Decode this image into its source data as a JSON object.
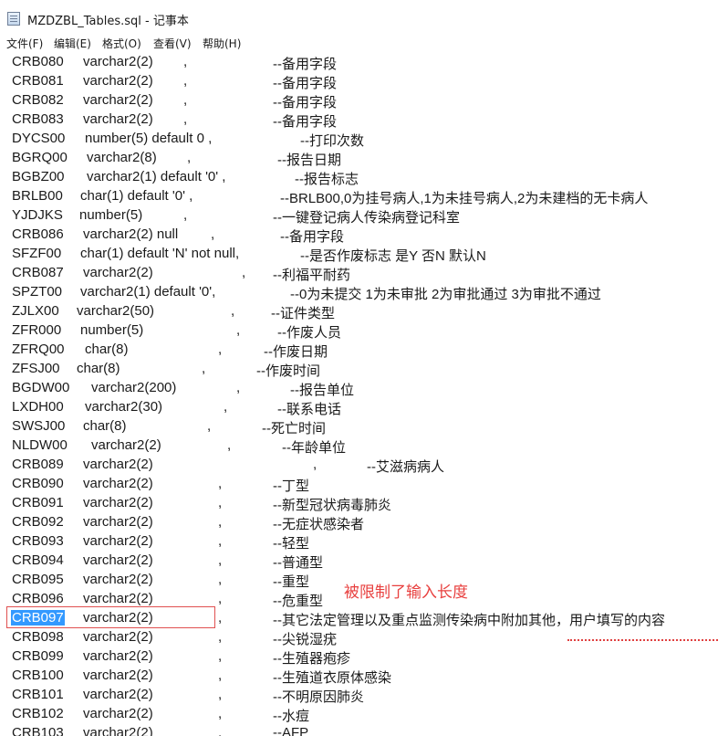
{
  "window": {
    "title": "MZDZBL_Tables.sql - 记事本"
  },
  "menu": {
    "file": "文件(F)",
    "edit": "编辑(E)",
    "format": "格式(O)",
    "view": "查看(V)",
    "help": "帮助(H)"
  },
  "annotation": {
    "text": "被限制了输入长度"
  },
  "lines": [
    {
      "name": "CRB080",
      "type": "varchar2(2)",
      "sep": ",",
      "comment": "--备用字段"
    },
    {
      "name": "CRB081",
      "type": "varchar2(2)",
      "sep": ",",
      "comment": "--备用字段"
    },
    {
      "name": "CRB082",
      "type": "varchar2(2)",
      "sep": ",",
      "comment": "--备用字段"
    },
    {
      "name": "CRB083",
      "type": "varchar2(2)",
      "sep": ",",
      "comment": "--备用字段"
    },
    {
      "name": "DYCS00",
      "type": "number(5) default 0 ,",
      "sep": "",
      "comment": "--打印次数"
    },
    {
      "name": "BGRQ00",
      "type": "varchar2(8)",
      "sep": ",",
      "comment": "--报告日期"
    },
    {
      "name": "BGBZ00",
      "type": "varchar2(1) default '0' ,",
      "sep": "",
      "comment": "--报告标志"
    },
    {
      "name": "BRLB00",
      "type": "char(1) default '0' ,",
      "sep": "",
      "comment": "--BRLB00,0为挂号病人,1为未挂号病人,2为未建档的无卡病人"
    },
    {
      "name": "YJDJKS",
      "type": "number(5)",
      "sep": ",",
      "comment": "--一键登记病人传染病登记科室"
    },
    {
      "name": "CRB086",
      "type": "varchar2(2) null",
      "sep": ",",
      "comment": "--备用字段"
    },
    {
      "name": "SFZF00",
      "type": "char(1) default 'N' not null,",
      "sep": "",
      "comment": "--是否作废标志 是Y 否N 默认N"
    },
    {
      "name": "CRB087",
      "type": "varchar2(2)",
      "sep": ",",
      "comment": "--利福平耐药"
    },
    {
      "name": "SPZT00",
      "type": "varchar2(1) default '0',",
      "sep": "",
      "comment": "--0为未提交 1为未审批 2为审批通过 3为审批不通过"
    },
    {
      "name": "ZJLX00",
      "type": "varchar2(50)",
      "sep": ",",
      "comment": "--证件类型"
    },
    {
      "name": "ZFR000",
      "type": "number(5)",
      "sep": ",",
      "comment": "--作废人员"
    },
    {
      "name": "ZFRQ00",
      "type": "char(8)",
      "sep": ",",
      "comment": "--作废日期"
    },
    {
      "name": "ZFSJ00",
      "type": "char(8)",
      "sep": ",",
      "comment": "--作废时间"
    },
    {
      "name": "BGDW00",
      "type": "varchar2(200)",
      "sep": ",",
      "comment": "--报告单位"
    },
    {
      "name": "LXDH00",
      "type": "varchar2(30)",
      "sep": ",",
      "comment": "--联系电话"
    },
    {
      "name": "SWSJ00",
      "type": "char(8)",
      "sep": ",",
      "comment": "--死亡时间"
    },
    {
      "name": "NLDW00",
      "type": "varchar2(2)",
      "sep": ",",
      "comment": "--年龄单位"
    },
    {
      "name": "CRB089",
      "type": "varchar2(2)",
      "sep": ",",
      "comment": "--艾滋病病人"
    },
    {
      "name": "CRB090",
      "type": "varchar2(2)",
      "sep": ",",
      "comment": "--丁型"
    },
    {
      "name": "CRB091",
      "type": "varchar2(2)",
      "sep": ",",
      "comment": "--新型冠状病毒肺炎"
    },
    {
      "name": "CRB092",
      "type": "varchar2(2)",
      "sep": ",",
      "comment": "--无症状感染者"
    },
    {
      "name": "CRB093",
      "type": "varchar2(2)",
      "sep": ",",
      "comment": "--轻型"
    },
    {
      "name": "CRB094",
      "type": "varchar2(2)",
      "sep": ",",
      "comment": "--普通型"
    },
    {
      "name": "CRB095",
      "type": "varchar2(2)",
      "sep": ",",
      "comment": "--重型"
    },
    {
      "name": "CRB096",
      "type": "varchar2(2)",
      "sep": ",",
      "comment": "--危重型"
    },
    {
      "name": "CRB097",
      "type": "varchar2(2)",
      "sep": ",",
      "comment": "--其它法定管理以及重点监测传染病中附加其他，用户填写的内容"
    },
    {
      "name": "CRB098",
      "type": "varchar2(2)",
      "sep": ",",
      "comment": "--尖锐湿疣"
    },
    {
      "name": "CRB099",
      "type": "varchar2(2)",
      "sep": ",",
      "comment": "--生殖器疱疹"
    },
    {
      "name": "CRB100",
      "type": "varchar2(2)",
      "sep": ",",
      "comment": "--生殖道衣原体感染"
    },
    {
      "name": "CRB101",
      "type": "varchar2(2)",
      "sep": ",",
      "comment": "--不明原因肺炎"
    },
    {
      "name": "CRB102",
      "type": "varchar2(2)",
      "sep": ",",
      "comment": "--水痘"
    },
    {
      "name": "CRB103",
      "type": "varchar2(2)",
      "sep": ",",
      "comment": "--AFP"
    }
  ]
}
